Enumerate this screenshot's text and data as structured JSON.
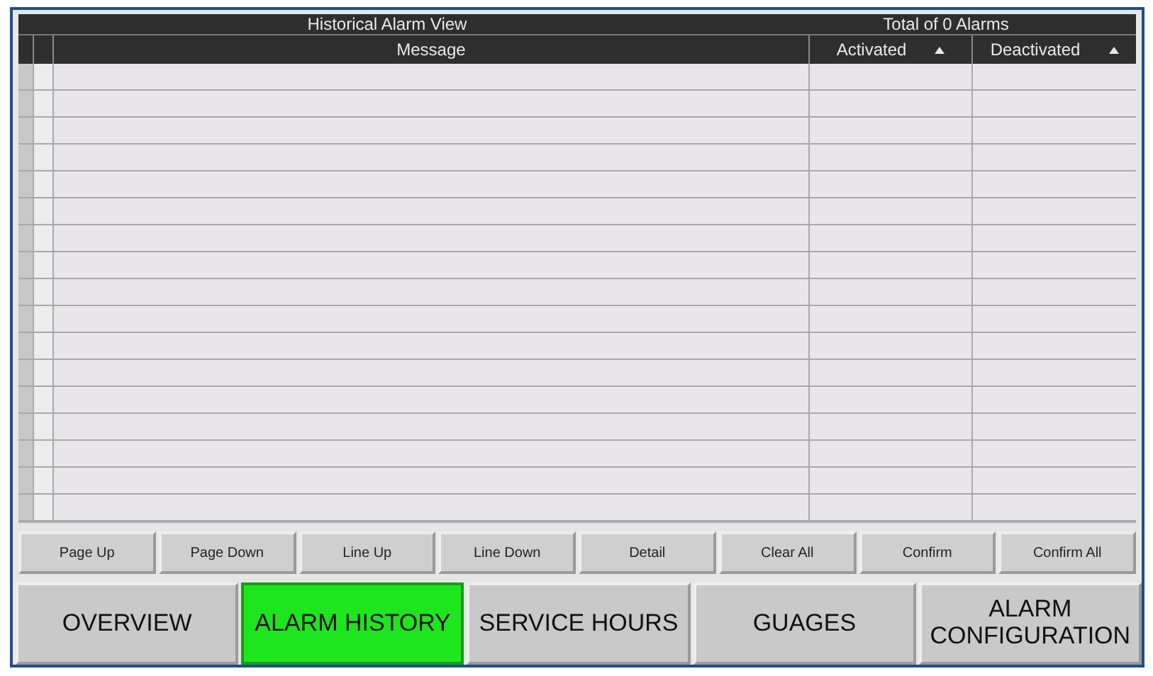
{
  "alarm_view": {
    "title": "Historical Alarm View",
    "total": "Total of 0 Alarms",
    "columns": [
      {
        "label": "Message",
        "sortable": false
      },
      {
        "label": "Activated",
        "sortable": true
      },
      {
        "label": "Deactivated",
        "sortable": true
      }
    ]
  },
  "buttons": [
    "Page Up",
    "Page Down",
    "Line Up",
    "Line Down",
    "Detail",
    "Clear All",
    "Confirm",
    "Confirm All"
  ],
  "nav": [
    {
      "label": "OVERVIEW",
      "selected": false
    },
    {
      "label": "ALARM HISTORY",
      "selected": true
    },
    {
      "label": "SERVICE HOURS",
      "selected": false
    },
    {
      "label": "GUAGES",
      "selected": false
    },
    {
      "label": "ALARM CONFIGURATION",
      "selected": false
    }
  ]
}
